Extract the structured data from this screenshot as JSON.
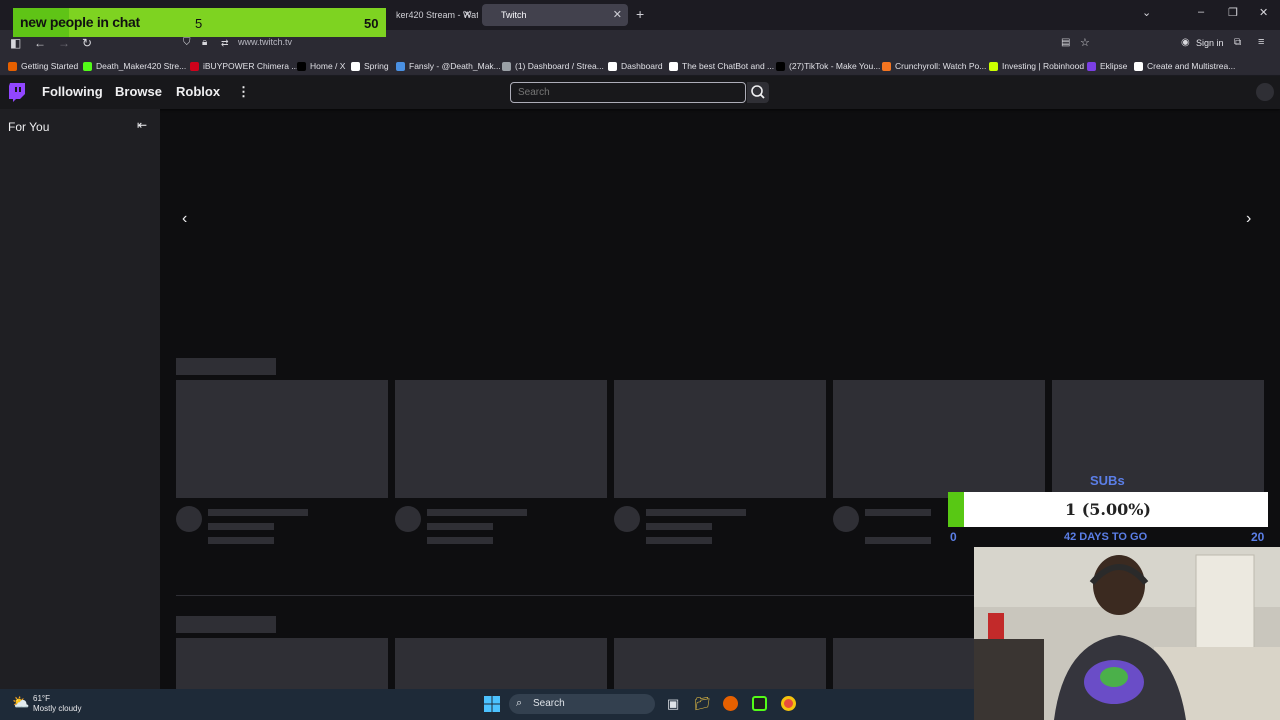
{
  "browser": {
    "tabs": [
      {
        "label": "ker420 Stream - Watc",
        "active": false
      },
      {
        "label": "Twitch",
        "active": true
      }
    ],
    "url": "www.twitch.tv",
    "sign_in": "Sign in",
    "bookmarks": [
      {
        "label": "Getting Started",
        "color": "#e66000"
      },
      {
        "label": "Death_Maker420 Stre...",
        "color": "#53fc18"
      },
      {
        "label": "iBUYPOWER Chimera ...",
        "color": "#d0021b"
      },
      {
        "label": "Home / X",
        "color": "#000000"
      },
      {
        "label": "Spring",
        "color": "#ffffff"
      },
      {
        "label": "Fansly - @Death_Mak...",
        "color": "#4a90e2"
      },
      {
        "label": "(1) Dashboard / Strea...",
        "color": "#9aa0a6"
      },
      {
        "label": "Dashboard",
        "color": "#ffffff"
      },
      {
        "label": "The best ChatBot and ...",
        "color": "#ffffff"
      },
      {
        "label": "(27)TikTok - Make You...",
        "color": "#000000"
      },
      {
        "label": "Crunchyroll: Watch Po...",
        "color": "#f47521"
      },
      {
        "label": "Investing | Robinhood",
        "color": "#ccff00"
      },
      {
        "label": "Eklipse",
        "color": "#7b3fe4"
      },
      {
        "label": "Create and Multistrea...",
        "color": "#ffffff"
      }
    ]
  },
  "twitch": {
    "nav": [
      "Following",
      "Browse",
      "Roblox"
    ],
    "search_placeholder": "Search",
    "sidebar_title": "For You",
    "brand_color": "#9146ff"
  },
  "overlay_new_people": {
    "label": "new people in chat",
    "current": "5",
    "goal": "50",
    "progress": 0.1
  },
  "overlay_subs": {
    "title": "SUBs",
    "progress_text": "1 (5.00%)",
    "progress": 0.05,
    "min": "0",
    "days_left": "42 DAYS TO GO",
    "max": "20"
  },
  "taskbar": {
    "temperature": "61°F",
    "weather": "Mostly cloudy",
    "search_label": "Search"
  }
}
